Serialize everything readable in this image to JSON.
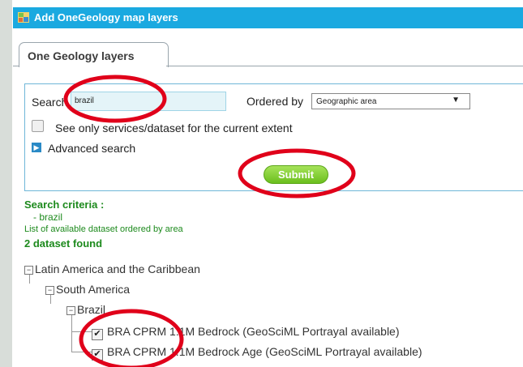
{
  "window": {
    "title": "Add OneGeology map layers"
  },
  "tabs": [
    {
      "label": "One Geology layers"
    }
  ],
  "search": {
    "label": "Search",
    "value": "brazil",
    "ordered_by_label": "Ordered by",
    "ordered_by_value": "Geographic area",
    "extent_checkbox_label": "See only services/dataset for the current extent",
    "extent_checked": false,
    "advanced_label": "Advanced search",
    "submit_label": "Submit"
  },
  "results": {
    "criteria_title": "Search criteria :",
    "criteria_item": "- brazil",
    "list_label": "List of available dataset ordered by area",
    "count_label": "2 dataset found"
  },
  "tree": {
    "level1": "Latin America and the Caribbean",
    "level2": "South America",
    "level3": "Brazil",
    "leaves": [
      {
        "label": "BRA CPRM 1:1M Bedrock (GeoSciML Portrayal available)",
        "checked": true
      },
      {
        "label": "BRA CPRM 1:1M Bedrock Age (GeoSciML Portrayal available)",
        "checked": true
      }
    ]
  },
  "icons": {
    "title_icon": "map-layers-icon",
    "advanced_icon": "expand-arrow-icon",
    "select_icon": "dropdown-arrow-icon",
    "tree_toggle": "collapse-minus-icon"
  },
  "colors": {
    "titlebar": "#1aa9e0",
    "accent_green": "#1d8a1d",
    "submit_green": "#6bbf1d",
    "annotation_red": "#e0001a"
  }
}
